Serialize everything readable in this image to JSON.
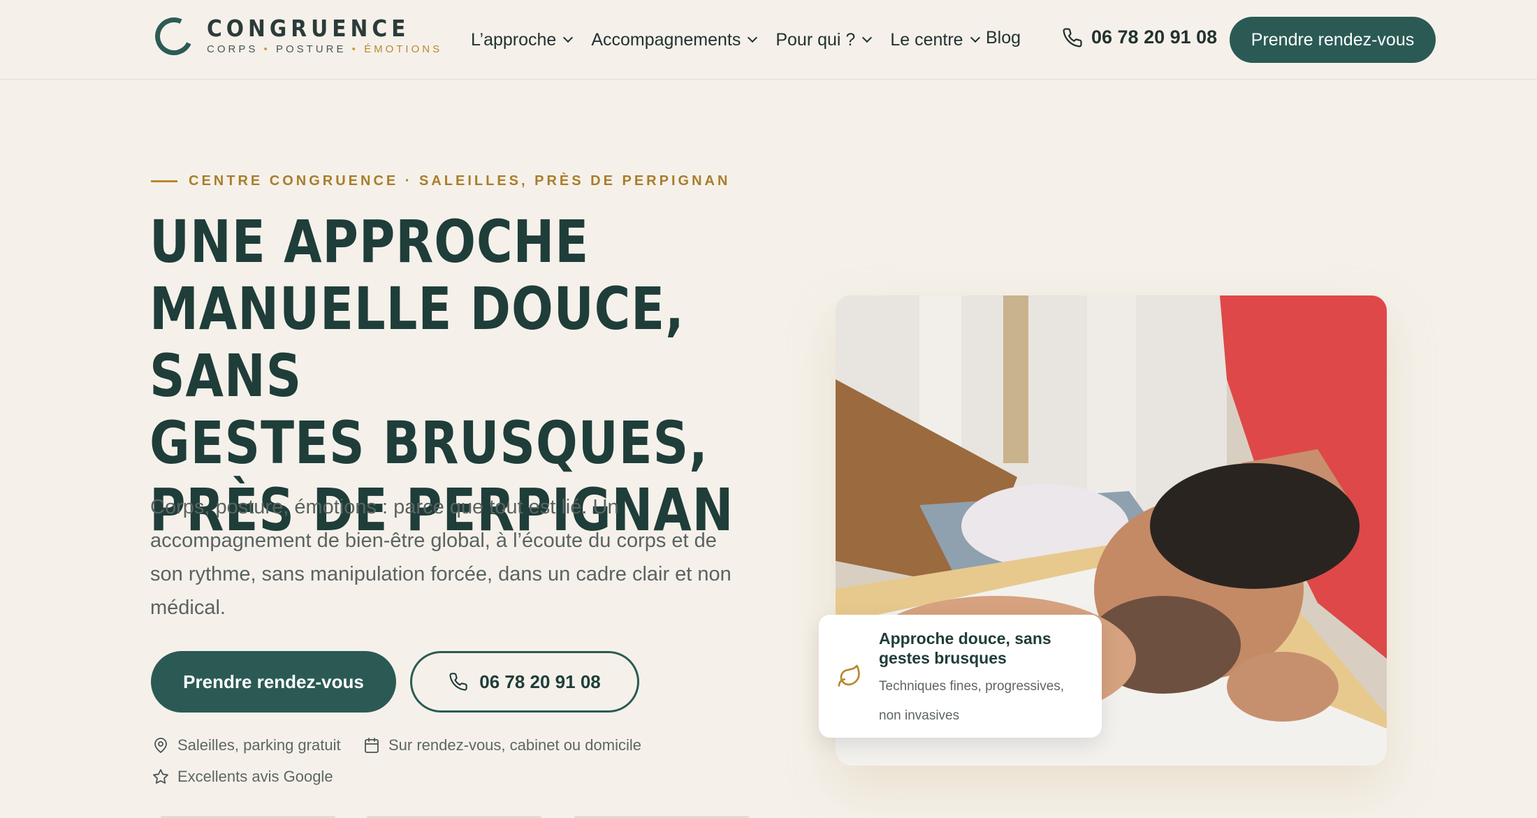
{
  "brand": {
    "name": "CONGRUENCE",
    "tag_1": "CORPS",
    "tag_2": "POSTURE",
    "tag_3": "ÉMOTIONS"
  },
  "nav": {
    "items": [
      {
        "label": "L’approche"
      },
      {
        "label": "Accompagnements"
      },
      {
        "label": "Pour qui ?"
      },
      {
        "label": "Le centre"
      }
    ],
    "blog": "Blog",
    "phone": "06 78 20 91 08",
    "cta": "Prendre rendez-vous"
  },
  "hero": {
    "eyebrow": "CENTRE CONGRUENCE · SALEILLES, PRÈS DE PERPIGNAN",
    "title_lines": [
      "UNE APPROCHE",
      "MANUELLE DOUCE, SANS",
      "GESTES BRUSQUES,",
      "PRÈS DE PERPIGNAN"
    ],
    "text": "Corps, posture, émotions : parce que tout est lié. Un accompagnement de bien-être global, à l’écoute du corps et de son rythme, sans manipulation forcée, dans un cadre clair et non médical.",
    "cta_primary": "Prendre rendez-vous",
    "cta_phone": "06 78 20 91 08",
    "meta": {
      "location": "Saleilles, parking gratuit",
      "schedule": "Sur rendez-vous, cabinet ou domicile",
      "reviews": "Excellents avis Google"
    }
  },
  "card": {
    "title": "Approche douce, sans gestes brusques",
    "subtitle": "Techniques fines, progressives, non invasives"
  },
  "colors": {
    "background": "#f5f1ea",
    "primary": "#2b5a54",
    "accent_gold": "#b8892f",
    "text_dark": "#1f3d39"
  },
  "icons": {
    "phone": "phone-icon",
    "location": "map-pin-icon",
    "calendar": "calendar-icon",
    "star": "star-icon",
    "leaf": "leaf-icon"
  }
}
